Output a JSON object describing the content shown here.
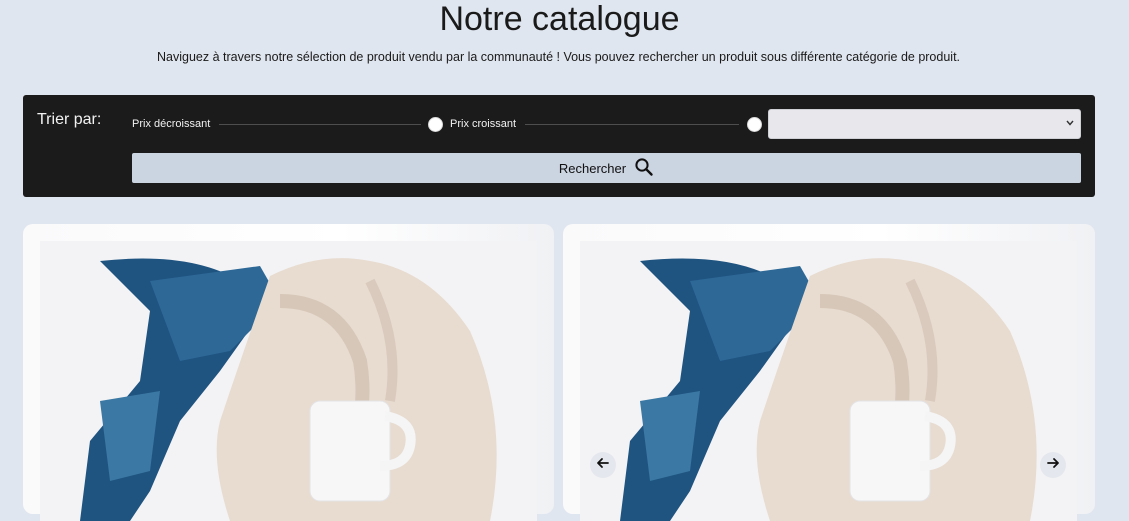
{
  "header": {
    "title": "Notre catalogue",
    "subtitle": "Naviguez à travers notre sélection de produit vendu par la communauté ! Vous pouvez rechercher un produit sous différente catégorie de produit."
  },
  "filters": {
    "sort_label": "Trier par:",
    "option_desc": "Prix décroissant",
    "option_asc": "Prix croissant",
    "category_select_value": "",
    "search_button_label": "Rechercher",
    "search_icon": "search-icon"
  },
  "products": [
    {
      "image": "clothes-flatlay-photo"
    },
    {
      "image": "clothes-flatlay-photo",
      "prev_icon": "arrow-left-icon",
      "next_icon": "arrow-right-icon"
    }
  ],
  "colors": {
    "background": "#e0e6ef",
    "filter_bar": "#1b1b1b",
    "search_button": "#cbd4e1"
  }
}
